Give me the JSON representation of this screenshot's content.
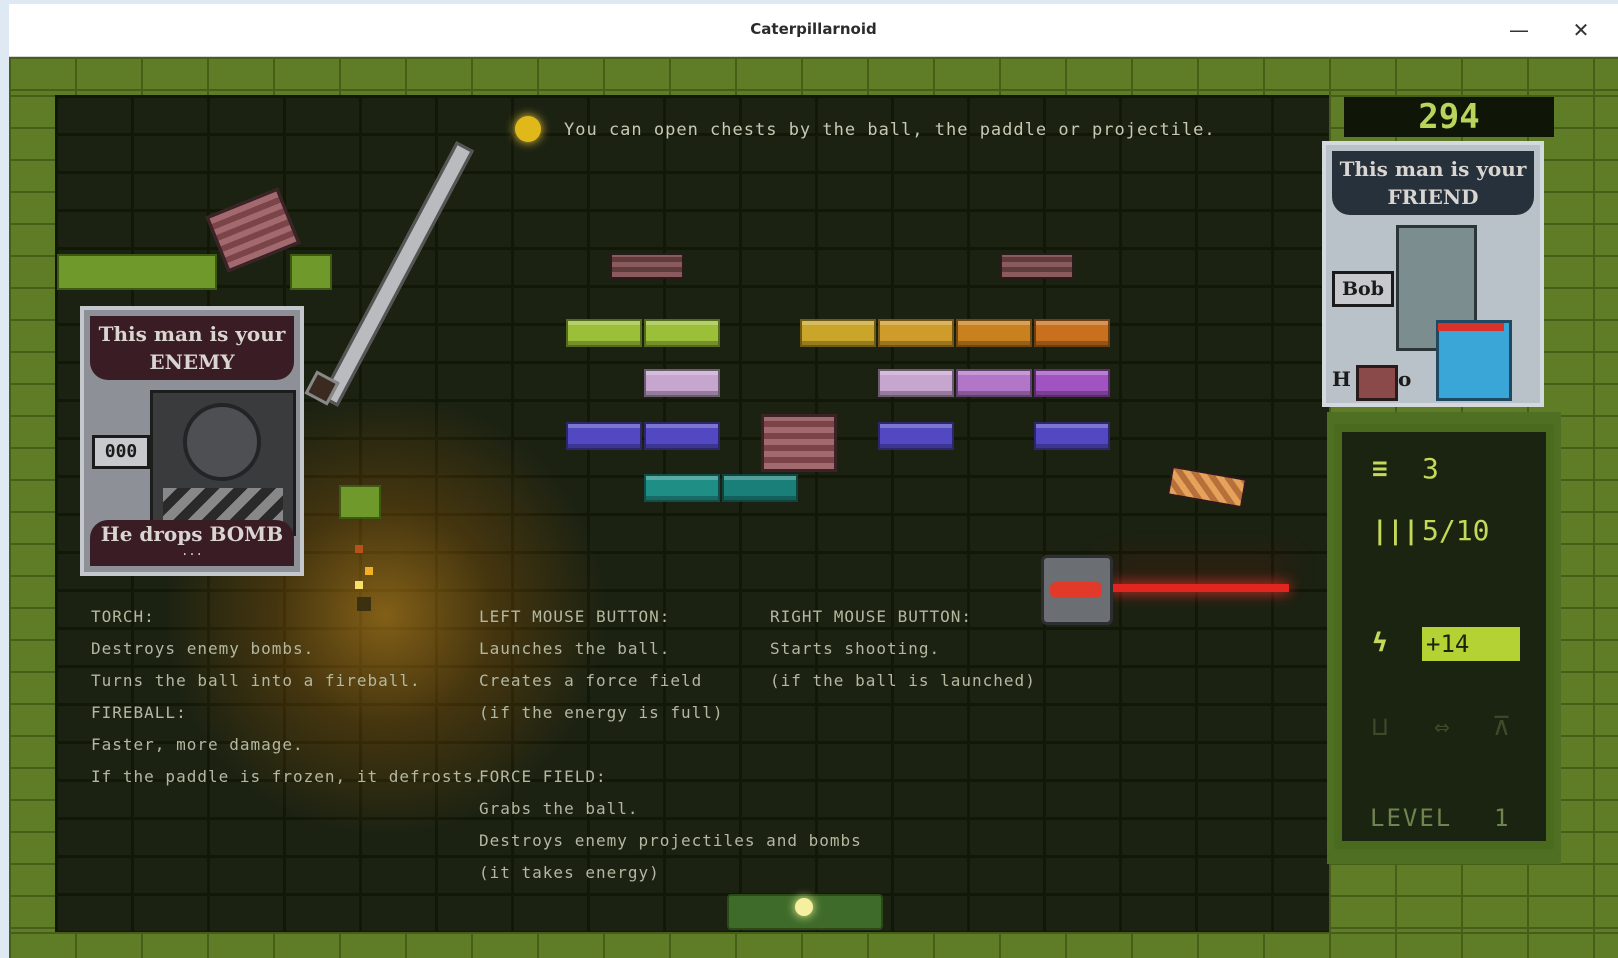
{
  "window": {
    "title": "Caterpillarnoid",
    "minimize_icon": "minimize-icon",
    "close_icon": "close-icon"
  },
  "hint": "You can open chests by the ball, the paddle or projectile.",
  "help": {
    "torch": [
      "TORCH:",
      "Destroys enemy bombs.",
      "Turns the ball into a fireball.",
      "FIREBALL:",
      "Faster, more damage.",
      "If the paddle is frozen, it defrosts."
    ],
    "left_mouse": [
      "LEFT MOUSE BUTTON:",
      "Launches the ball.",
      "Creates a force field",
      "(if the energy is full)"
    ],
    "force_field": [
      "FORCE FIELD:",
      "Grabs the ball.",
      "Destroys enemy projectiles and bombs",
      "(it takes energy)"
    ],
    "right_mouse": [
      "RIGHT MOUSE BUTTON:",
      "Starts shooting.",
      "(if the ball is launched)"
    ]
  },
  "enemy_card": {
    "header": "This man is your ENEMY",
    "id_label": "000",
    "footer": "He drops BOMB",
    "footer_dots": "..."
  },
  "friend_card": {
    "header": "This man is your FRIEND",
    "name_label": "Bob",
    "partial_letters": "H",
    "partial_letters_2": "o"
  },
  "hud": {
    "score": "294",
    "lives": "3",
    "ammo": "5/10",
    "energy": "+14",
    "level_label": "LEVEL",
    "level_value": "1"
  },
  "colors": {
    "green_brick": "#9cbf3a",
    "gold_brick": "#c9a52a",
    "orange_brick": "#c97a1e",
    "lilac_brick": "#c6a6cf",
    "purple_brick": "#a053c1",
    "blue_brick": "#5248c2",
    "teal_brick": "#1f8f86",
    "laser": "#e0261f"
  }
}
